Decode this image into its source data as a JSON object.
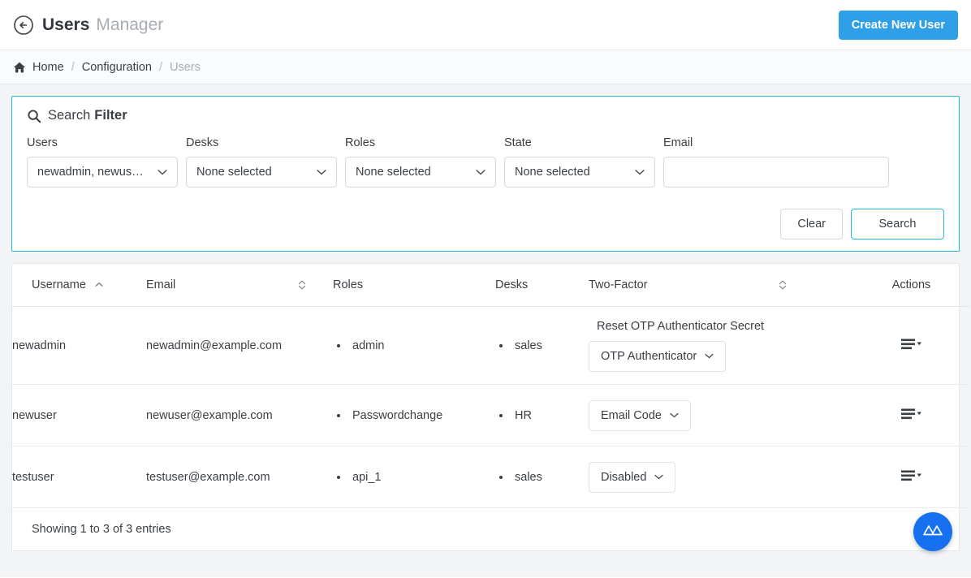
{
  "header": {
    "back_icon": "back-arrow-circle-icon",
    "title_main": "Users",
    "title_sub": "Manager",
    "create_button": "Create New User"
  },
  "breadcrumb": {
    "home_icon": "home-icon",
    "home": "Home",
    "separator": "/",
    "configuration": "Configuration",
    "current": "Users"
  },
  "filter": {
    "icon": "search-icon",
    "title_light": "Search",
    "title_bold": "Filter",
    "fields": {
      "users": {
        "label": "Users",
        "value": "newadmin, newus…"
      },
      "desks": {
        "label": "Desks",
        "value": "None selected"
      },
      "roles": {
        "label": "Roles",
        "value": "None selected"
      },
      "state": {
        "label": "State",
        "value": "None selected"
      },
      "email": {
        "label": "Email",
        "value": "",
        "placeholder": ""
      }
    },
    "clear_button": "Clear",
    "search_button": "Search"
  },
  "table": {
    "columns": {
      "username": "Username",
      "email": "Email",
      "roles": "Roles",
      "desks": "Desks",
      "twofactor": "Two-Factor",
      "actions": "Actions"
    },
    "sort": {
      "username": "sort-ascending-icon",
      "email": "sort-both-icon",
      "twofactor": "sort-both-icon"
    },
    "rows": [
      {
        "username": "newadmin",
        "email": "newadmin@example.com",
        "roles": [
          "admin"
        ],
        "desks": [
          "sales"
        ],
        "reset_link": "Reset OTP Authenticator Secret",
        "twofactor": "OTP Authenticator",
        "actions_icon": "actions-menu-icon"
      },
      {
        "username": "newuser",
        "email": "newuser@example.com",
        "roles": [
          "Passwordchange"
        ],
        "desks": [
          "HR"
        ],
        "reset_link": "",
        "twofactor": "Email Code",
        "actions_icon": "actions-menu-icon"
      },
      {
        "username": "testuser",
        "email": "testuser@example.com",
        "roles": [
          "api_1"
        ],
        "desks": [
          "sales"
        ],
        "reset_link": "",
        "twofactor": "Disabled",
        "actions_icon": "actions-menu-icon"
      }
    ],
    "footer": "Showing 1 to 3 of 3 entries"
  },
  "fab": {
    "icon": "app-logo-icon"
  },
  "colors": {
    "primary_blue": "#2f9fe8",
    "accent_teal": "#21bcd4",
    "fab_blue": "#1670f0",
    "text": "#3a3f44",
    "muted": "#a7adb3",
    "page_bg": "#f3f4f6"
  }
}
